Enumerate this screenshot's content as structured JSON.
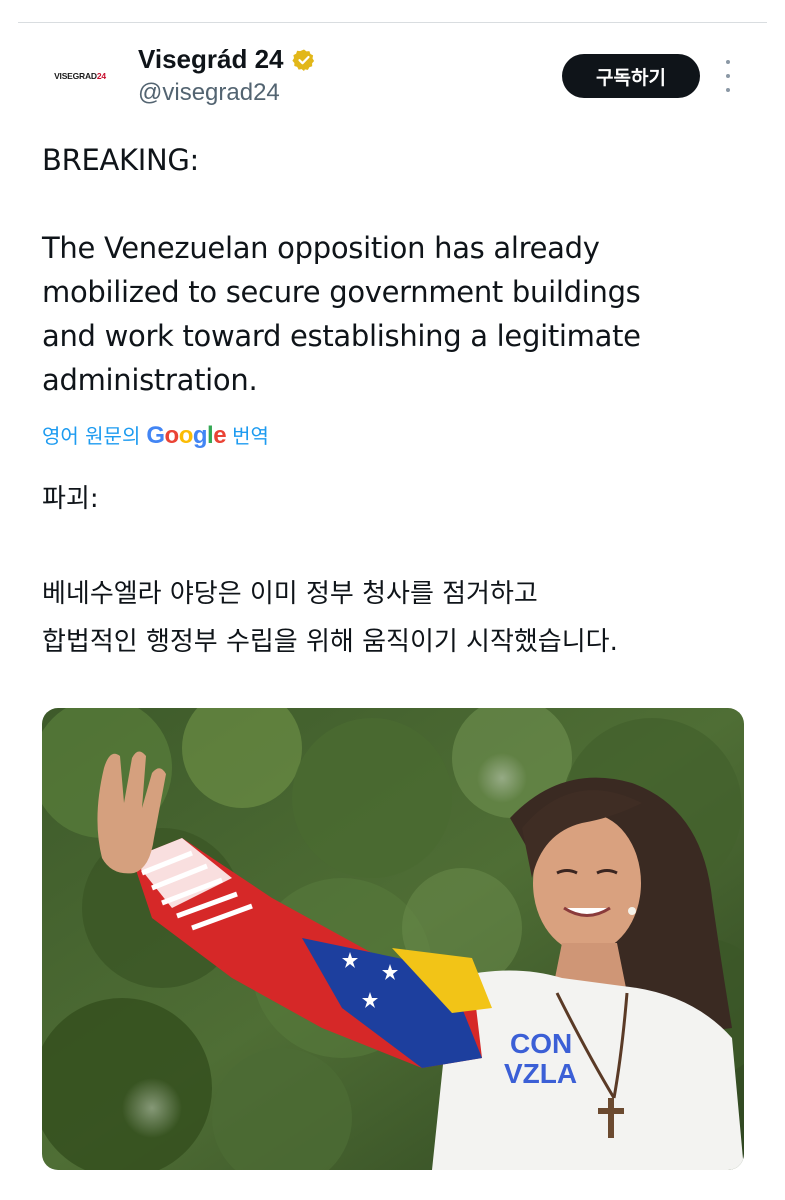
{
  "account": {
    "avatar_text": "VISEGRAD",
    "avatar_accent": "24",
    "display_name": "Visegrád 24",
    "handle": "@visegrad24"
  },
  "actions": {
    "subscribe_label": "구독하기"
  },
  "tweet": {
    "headline": "BREAKING:",
    "body": "The Venezuelan opposition has already\nmobilized to secure government buildings\nand work toward establishing a legitimate\nadministration."
  },
  "translation": {
    "prefix": "영어 원문의",
    "google_G": "G",
    "google_o1": "o",
    "google_o2": "o",
    "google_g": "g",
    "google_l": "l",
    "google_e": "e",
    "suffix": "번역",
    "headline": "파괴:",
    "body": "베네수엘라 야당은 이미 정부 청사를 점거하고\n합법적인 행정부 수립을 위해 움직이기 시작했습니다."
  },
  "media": {
    "shirt_text_line1": "CON",
    "shirt_text_line2": "VZLA"
  },
  "colors": {
    "accent_blue": "#1d9bf0",
    "verified_gold": "#e2b719",
    "text_primary": "#0f1419",
    "text_secondary": "#536471"
  },
  "icons": {
    "verified": "verified-badge-icon",
    "more": "more-options-icon"
  }
}
